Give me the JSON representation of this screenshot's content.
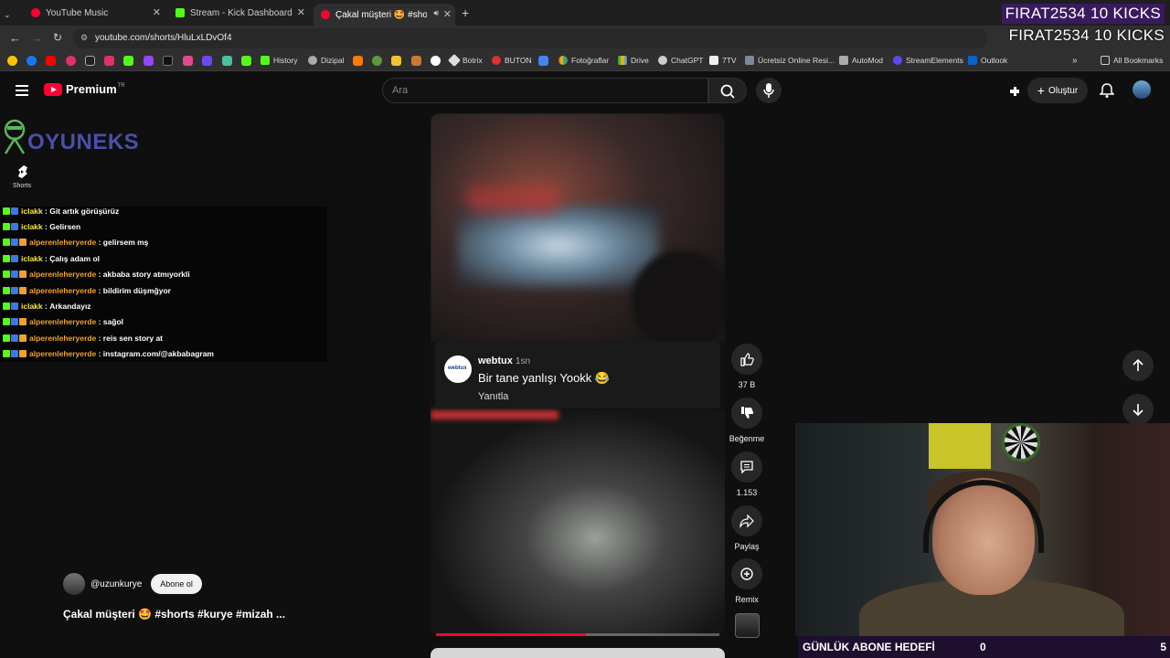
{
  "browser": {
    "tabs": [
      {
        "title": "YouTube Music",
        "color": "#ff0033"
      },
      {
        "title": "Stream - Kick Dashboard",
        "color": "#53fc18"
      },
      {
        "title": "Çakal müşteri 🤩 #shorts #",
        "color": "#ff0033"
      }
    ],
    "url": "youtube.com/shorts/HluLxLDvOf4",
    "bookmarks": [
      "History",
      "Dizipal",
      "Botrix",
      "BUTON",
      "Fotoğraflar",
      "Drive",
      "ChatGPT",
      "7TV",
      "Ücretsiz Online Resi...",
      "AutoMod",
      "StreamElements",
      "Outlook"
    ],
    "all_bookmarks": "All Bookmarks"
  },
  "overlay": {
    "kicks_text": "FIRAT2534  10 KICKS",
    "brand": "OYUNEKS",
    "goal_label": "GÜNLÜK ABONE HEDEFİ",
    "goal_current": "0",
    "goal_target": "5"
  },
  "chat": [
    {
      "user": "iclakk",
      "color": "yellow",
      "msg": "Git artık görüşürüz"
    },
    {
      "user": "iclakk",
      "color": "yellow",
      "msg": "Gelirsen"
    },
    {
      "user": "alperenleheryerde",
      "color": "orange",
      "msg": "gelirsem mş"
    },
    {
      "user": "iclakk",
      "color": "yellow",
      "msg": "Çalış adam ol"
    },
    {
      "user": "alperenleheryerde",
      "color": "orange",
      "msg": "akbaba story atmıyorkli"
    },
    {
      "user": "alperenleheryerde",
      "color": "orange",
      "msg": "bildirim düşmğyor"
    },
    {
      "user": "iclakk",
      "color": "yellow",
      "msg": "Arkandayız"
    },
    {
      "user": "alperenleheryerde",
      "color": "orange",
      "msg": "sağol"
    },
    {
      "user": "alperenleheryerde",
      "color": "orange",
      "msg": "reis sen story at"
    },
    {
      "user": "alperenleheryerde",
      "color": "orange",
      "msg": "instagram.com/@akbabagram"
    }
  ],
  "youtube": {
    "logo_text": "Premium",
    "logo_region": "TR",
    "search_placeholder": "Ara",
    "create_label": "Oluştur",
    "sidebar_shorts": "Shorts",
    "comment": {
      "user": "webtux",
      "time": "1sn",
      "text": "Bir tane yanlışı Yookk 😂",
      "reply": "Yanıtla",
      "avatar_text": "webtux"
    },
    "actions": {
      "likes": "37 B",
      "dislike": "Beğenme",
      "comments": "1.153",
      "share": "Paylaş",
      "remix": "Remix"
    },
    "channel": "@uzunkurye",
    "subscribe": "Abone ol",
    "short_title": "Çakal müşteri 🤩 #shorts #kurye #mizah ...",
    "progress": 0.53
  }
}
